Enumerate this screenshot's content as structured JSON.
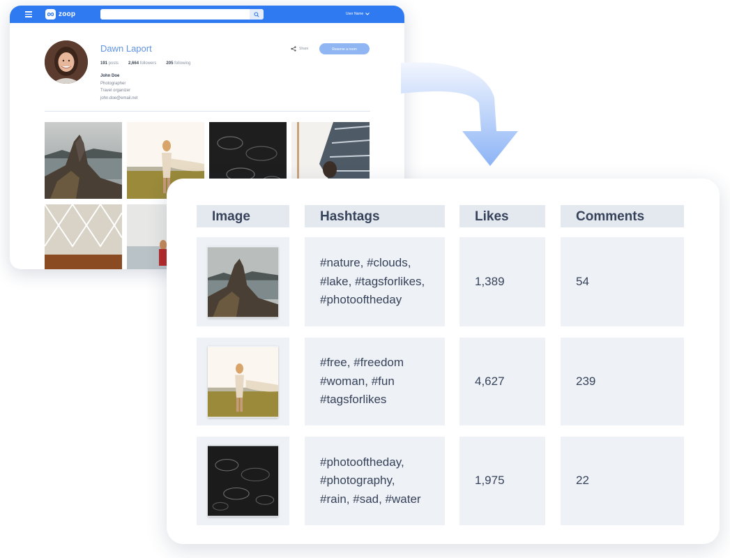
{
  "app": {
    "logo_text": "zoop",
    "search": {
      "placeholder": "",
      "value": ""
    },
    "user_menu_label": "User Name"
  },
  "profile": {
    "name": "Dawn Laport",
    "stats": {
      "posts_count": "191",
      "posts_label": "posts",
      "followers_count": "2,664",
      "followers_label": "followers",
      "following_count": "205",
      "following_label": "following"
    },
    "bio": {
      "name": "John Doe",
      "lines": [
        "Photographer",
        "Travel organizer",
        "john.doe@email.net"
      ]
    },
    "share_label": "Share",
    "reserve_label": "Reserve a room"
  },
  "table": {
    "headers": [
      "Image",
      "Hashtags",
      "Likes",
      "Comments"
    ],
    "rows": [
      {
        "image": "mountain-lake-photo",
        "hashtags": [
          "#nature, #clouds,",
          "#lake, #tagsforlikes,",
          "#photooftheday"
        ],
        "likes": "1,389",
        "comments": "54"
      },
      {
        "image": "woman-field-photo",
        "hashtags": [
          "#free, #freedom",
          "#woman, #fun",
          "#tagsforlikes"
        ],
        "likes": "4,627",
        "comments": "239"
      },
      {
        "image": "rain-water-photo",
        "hashtags": [
          "#photooftheday,",
          "#photography,",
          "#rain, #sad, #water"
        ],
        "likes": "1,975",
        "comments": "22"
      }
    ]
  },
  "colors": {
    "accent": "#2f7af0",
    "name_link": "#5e92e6",
    "button": "#8fb6f3",
    "table_header": "#e4e9ef",
    "table_cell": "#eef1f5"
  }
}
